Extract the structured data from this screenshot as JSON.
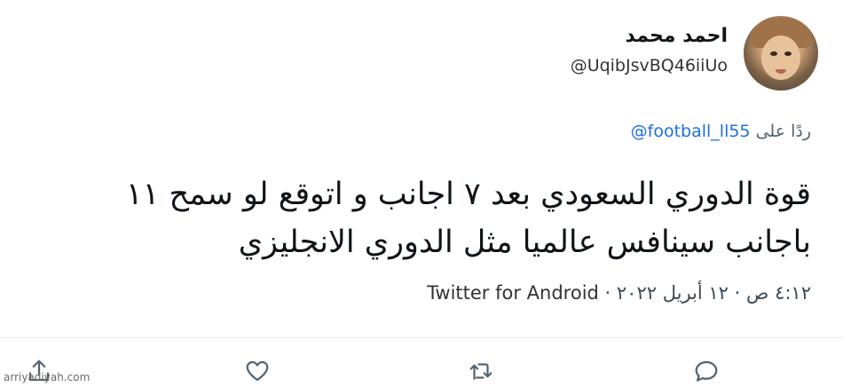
{
  "profile": {
    "display_name": "احمد محمد",
    "handle": "@UqibJsvBQ46iiUo"
  },
  "reply": {
    "prefix": "ردًا على",
    "mention": "@football_ll55"
  },
  "tweet": {
    "text": "قوة الدوري السعودي بعد ٧ اجانب و اتوقع لو سمح ١١ باجانب   سينافس عالميا مثل الدوري الانجليزي"
  },
  "meta": {
    "time": "٤:١٢ ص",
    "sep1": " · ",
    "date": "١٢ أبريل ٢٠٢٢",
    "sep2": " · ",
    "source": "Twitter for Android"
  },
  "actions": {
    "share_icon": "share-icon",
    "like_icon": "heart-icon",
    "retweet_icon": "retweet-icon",
    "reply_icon": "reply-icon"
  },
  "watermark": "arriyadiyah.com",
  "colors": {
    "link": "#1d6fe0",
    "action_icon": "#536471"
  }
}
